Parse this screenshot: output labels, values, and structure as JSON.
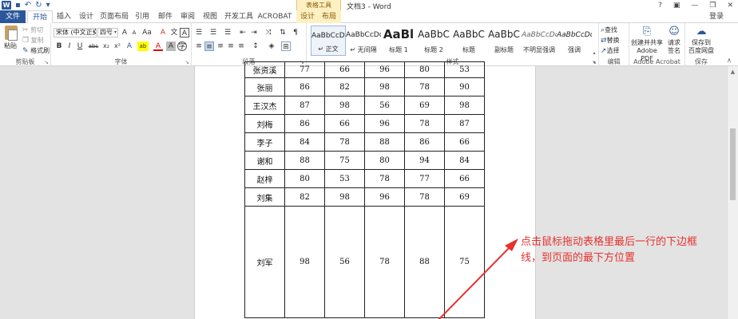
{
  "titlebar": {
    "app_icon": "W",
    "undo_glyph": "↶",
    "redo_glyph": "↻",
    "more_glyph": "▾",
    "contextual_group": "表格工具",
    "doc_title": "文档3 - Word",
    "help": "?",
    "options": "▣",
    "minimize": "—",
    "restore": "❐",
    "close": "✕"
  },
  "tabs": [
    "文件",
    "开始",
    "插入",
    "设计",
    "页面布局",
    "引用",
    "邮件",
    "审阅",
    "视图",
    "开发工具",
    "ACROBAT",
    "设计",
    "布局"
  ],
  "signin": "登录",
  "ribbon": {
    "clipboard": {
      "label": "剪贴板",
      "paste": "粘贴",
      "cut": "剪切",
      "copy": "复制",
      "format_painter": "格式刷"
    },
    "font": {
      "label": "字体",
      "font_name": "宋体 (中文正文)",
      "font_size": "四号",
      "grow": "A",
      "shrink": "A",
      "case": "Aa",
      "clear": "A",
      "phonetic": "文",
      "border": "A",
      "bold": "B",
      "italic": "I",
      "underline": "U",
      "strike": "abc",
      "sub": "x₂",
      "sup": "x²",
      "effects": "A",
      "highlight": "ab",
      "color": "A",
      "shade": "A",
      "enclose": "字"
    },
    "paragraph": {
      "label": "段落"
    },
    "styles": {
      "label": "样式",
      "items": [
        {
          "sample": "AaBbCcDd",
          "name": "↵ 正文"
        },
        {
          "sample": "AaBbCcDd",
          "name": "↵ 无间隔"
        },
        {
          "sample": "AaBl",
          "name": "标题 1"
        },
        {
          "sample": "AaBbC",
          "name": "标题 2"
        },
        {
          "sample": "AaBbC",
          "name": "标题"
        },
        {
          "sample": "AaBbC",
          "name": "副标题"
        },
        {
          "sample": "AaBbCcDd",
          "name": "不明显强调"
        },
        {
          "sample": "AaBbCcDd",
          "name": "强调"
        }
      ]
    },
    "editing": {
      "label": "编辑",
      "find": "查找",
      "replace": "替换",
      "select": "选择"
    },
    "acrobat": {
      "label": "Adobe Acrobat",
      "create_share": "创建并共享",
      "create_share_2": "Adobe PDF",
      "request_sign": "请求",
      "request_sign_2": "签名"
    },
    "save": {
      "label": "保存",
      "save_to": "保存到",
      "save_to_2": "百度网盘"
    }
  },
  "table": {
    "rows": [
      {
        "name": "张资溪",
        "scores": [
          "77",
          "66",
          "96",
          "80",
          "53"
        ]
      },
      {
        "name": "张丽",
        "scores": [
          "86",
          "82",
          "98",
          "78",
          "90"
        ]
      },
      {
        "name": "王汉杰",
        "scores": [
          "87",
          "98",
          "56",
          "69",
          "98"
        ]
      },
      {
        "name": "刘梅",
        "scores": [
          "86",
          "66",
          "96",
          "78",
          "87"
        ]
      },
      {
        "name": "李子",
        "scores": [
          "84",
          "78",
          "88",
          "86",
          "66"
        ]
      },
      {
        "name": "谢和",
        "scores": [
          "88",
          "75",
          "80",
          "94",
          "84"
        ]
      },
      {
        "name": "赵梓",
        "scores": [
          "80",
          "53",
          "78",
          "77",
          "66"
        ]
      },
      {
        "name": "刘集",
        "scores": [
          "82",
          "98",
          "96",
          "78",
          "69"
        ]
      },
      {
        "name": "刘军",
        "scores": [
          "98",
          "56",
          "78",
          "88",
          "75"
        ]
      }
    ]
  },
  "annotation": {
    "line1": "点击鼠标拖动表格里最后一行的下边框",
    "line2": "线，到页面的最下方位置",
    "color": "#e5322d"
  },
  "colors": {
    "word_blue": "#2b579a",
    "contextual_tab": "#fdf0c2"
  }
}
